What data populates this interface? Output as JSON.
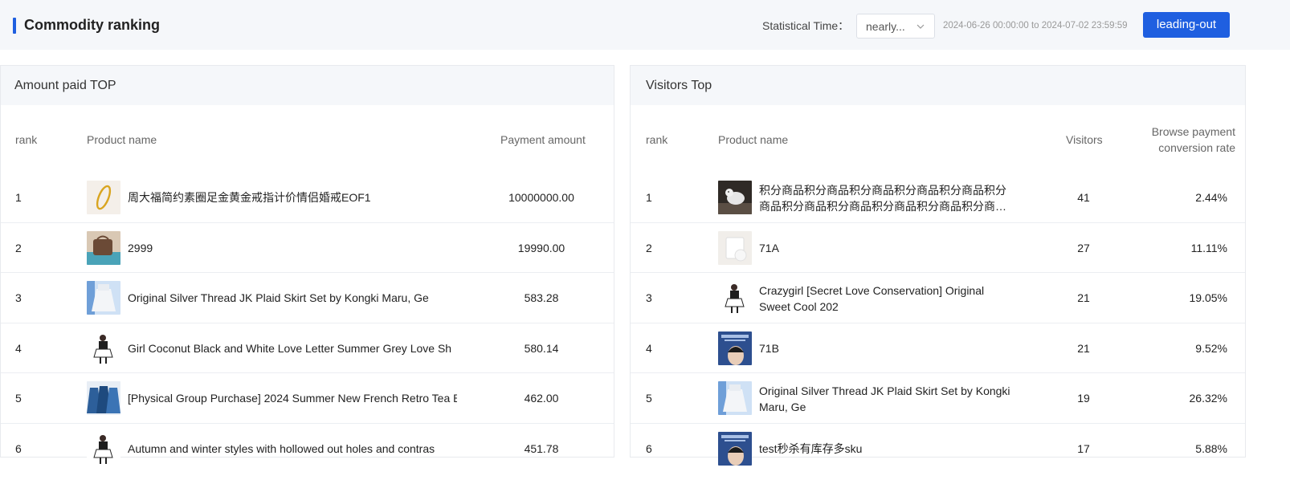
{
  "header": {
    "title": "Commodity ranking",
    "stat_label": "Statistical Time：",
    "time_select_value": "nearly...",
    "date_range": "2024-06-26 00:00:00 to 2024-07-02 23:59:59",
    "export_label": "leading-out"
  },
  "colors": {
    "accent": "#1f5fe0",
    "header_bg": "#f5f7fa",
    "border": "#e8eaee"
  },
  "amount_panel": {
    "title": "Amount paid TOP",
    "columns": {
      "rank": "rank",
      "product": "Product name",
      "amount": "Payment amount"
    },
    "rows": [
      {
        "rank": "1",
        "name": "周大福简约素圈足金黄金戒指计价情侣婚戒EOF1",
        "amount": "10000000.00",
        "thumb": "gold-ring"
      },
      {
        "rank": "2",
        "name": "2999",
        "amount": "19990.00",
        "thumb": "brown-bag"
      },
      {
        "rank": "3",
        "name": "Original Silver Thread JK Plaid Skirt Set by Kongki Maru, Ge",
        "amount": "583.28",
        "thumb": "white-skirt"
      },
      {
        "rank": "4",
        "name": "Girl Coconut Black and White Love Letter Summer Grey Love Sh",
        "amount": "580.14",
        "thumb": "bw-outfit"
      },
      {
        "rank": "5",
        "name": "[Physical Group Purchase] 2024 Summer New French Retro Tea B",
        "amount": "462.00",
        "thumb": "blue-dresses"
      },
      {
        "rank": "6",
        "name": "Autumn and winter styles with hollowed out holes and contras",
        "amount": "451.78",
        "thumb": "bw-outfit"
      }
    ]
  },
  "visitors_panel": {
    "title": "Visitors Top",
    "columns": {
      "rank": "rank",
      "product": "Product name",
      "visitors": "Visitors",
      "conversion_line1": "Browse payment",
      "conversion_line2": "conversion rate"
    },
    "rows": [
      {
        "rank": "1",
        "name": "积分商品积分商品积分商品积分商品积分商品积分商品积分商品积分商品积分商品积分商品积分商品积…",
        "multiline": true,
        "visitors": "41",
        "rate": "2.44%",
        "thumb": "pigeon"
      },
      {
        "rank": "2",
        "name": "71A",
        "multiline": false,
        "visitors": "27",
        "rate": "11.11%",
        "thumb": "white-box"
      },
      {
        "rank": "3",
        "name": "Crazygirl [Secret Love Conservation] Original Sweet Cool 202",
        "multiline": true,
        "visitors": "21",
        "rate": "19.05%",
        "thumb": "bw-outfit"
      },
      {
        "rank": "4",
        "name": "71B",
        "multiline": false,
        "visitors": "21",
        "rate": "9.52%",
        "thumb": "blue-poster"
      },
      {
        "rank": "5",
        "name": "Original Silver Thread JK Plaid Skirt Set by Kongki Maru, Ge",
        "multiline": true,
        "visitors": "19",
        "rate": "26.32%",
        "thumb": "white-skirt"
      },
      {
        "rank": "6",
        "name": "test秒杀有库存多sku",
        "multiline": false,
        "visitors": "17",
        "rate": "5.88%",
        "thumb": "blue-poster"
      }
    ]
  }
}
